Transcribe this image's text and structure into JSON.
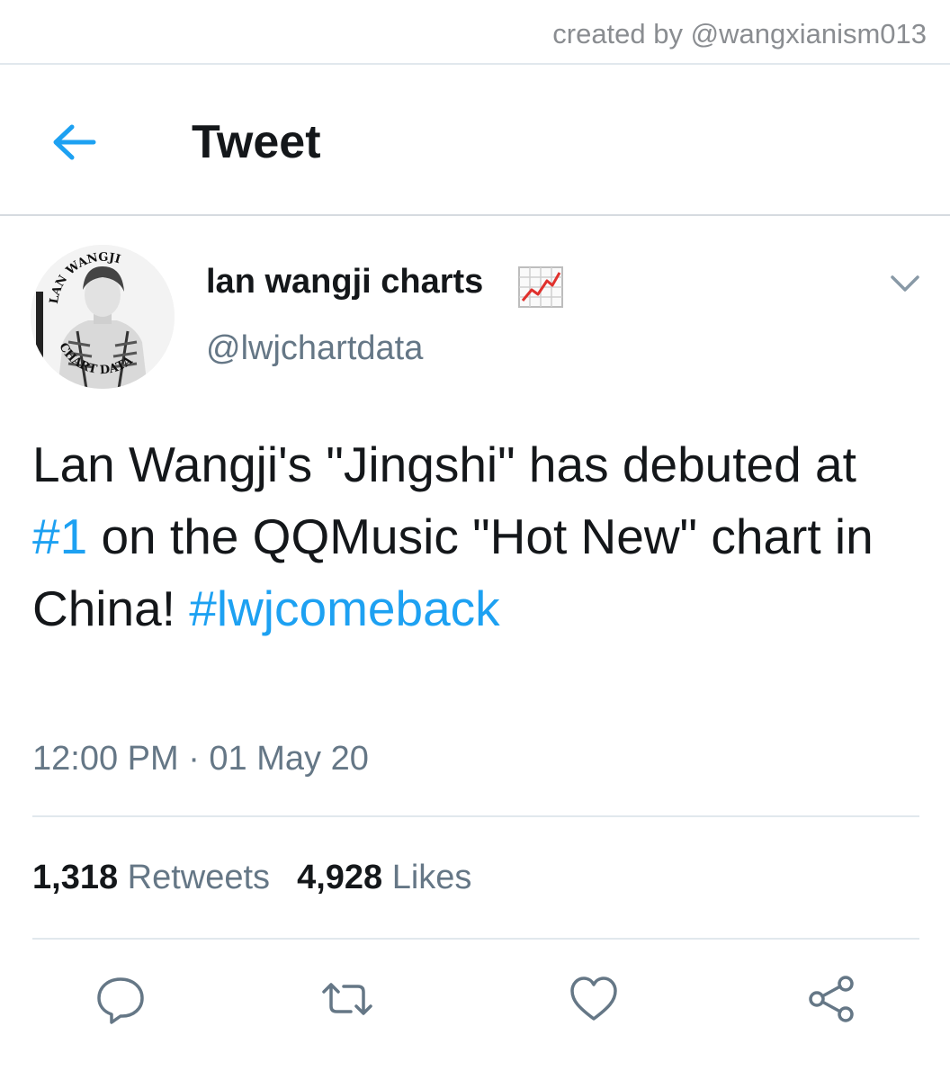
{
  "credit": "created by @wangxianism013",
  "header": {
    "title": "Tweet",
    "back_icon": "arrow-left-icon"
  },
  "colors": {
    "accent": "#1da1f2",
    "secondary_text": "#657786",
    "divider": "#e1e8ed"
  },
  "tweet": {
    "author": {
      "display_name": "lan wangji charts",
      "emoji": "chart-increasing-emoji",
      "handle": "@lwjchartdata",
      "avatar": {
        "top_text": "LAN WANGJI",
        "bottom_text": "CHART DATA"
      }
    },
    "text": {
      "part1": "Lan Wangji's \"Jingshi\" has debuted at ",
      "hashtag1": "#1",
      "part2": " on the QQMusic \"Hot New\" chart in China! ",
      "hashtag2": "#lwjcomeback"
    },
    "timestamp": "12:00 PM · 01 May 20",
    "stats": {
      "retweets_count": "1,318",
      "retweets_label": "Retweets",
      "likes_count": "4,928",
      "likes_label": "Likes"
    },
    "actions": [
      "reply-icon",
      "retweet-icon",
      "like-icon",
      "share-icon"
    ]
  }
}
